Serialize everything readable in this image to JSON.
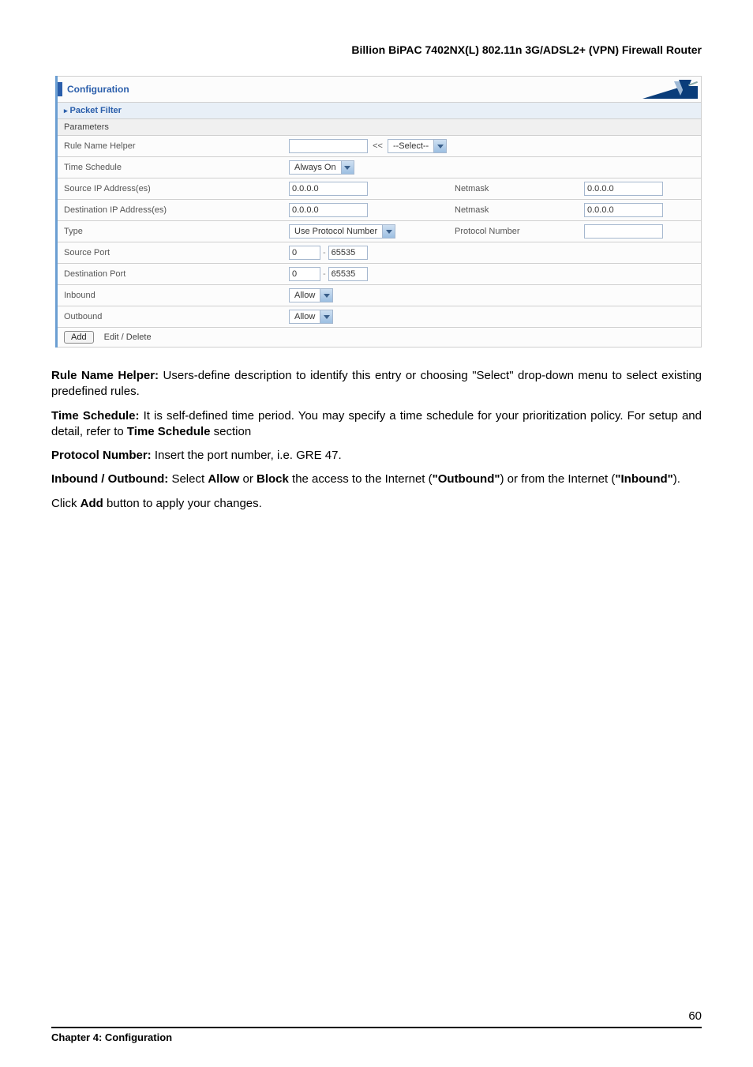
{
  "docTitle": "Billion BiPAC 7402NX(L) 802.11n 3G/ADSL2+ (VPN) Firewall Router",
  "panel": {
    "headerTitle": "Configuration",
    "sectionTitle": "Packet Filter",
    "parametersLabel": "Parameters"
  },
  "rows": {
    "ruleName": {
      "label": "Rule Name Helper",
      "inputValue": "",
      "arrow": "<<",
      "selectValue": "--Select--"
    },
    "timeSchedule": {
      "label": "Time Schedule",
      "selectValue": "Always On"
    },
    "sourceIP": {
      "label": "Source IP Address(es)",
      "value": "0.0.0.0",
      "netmaskLabel": "Netmask",
      "netmaskValue": "0.0.0.0"
    },
    "destIP": {
      "label": "Destination IP Address(es)",
      "value": "0.0.0.0",
      "netmaskLabel": "Netmask",
      "netmaskValue": "0.0.0.0"
    },
    "type": {
      "label": "Type",
      "selectValue": "Use Protocol Number",
      "protoLabel": "Protocol Number",
      "protoValue": ""
    },
    "sourcePort": {
      "label": "Source Port",
      "from": "0",
      "to": "65535"
    },
    "destPort": {
      "label": "Destination Port",
      "from": "0",
      "to": "65535"
    },
    "inbound": {
      "label": "Inbound",
      "selectValue": "Allow"
    },
    "outbound": {
      "label": "Outbound",
      "selectValue": "Allow"
    }
  },
  "buttons": {
    "add": "Add",
    "editDelete": "Edit / Delete"
  },
  "paragraphs": {
    "p1a": "Rule Name Helper:",
    "p1b": " Users-define description to identify this entry or choosing \"Select\" drop-down menu to select existing predefined rules.",
    "p2a": "Time Schedule:",
    "p2b": " It is self-defined time period.   You may specify a time schedule for your prioritization policy. For setup and detail, refer to ",
    "p2c": "Time Schedule",
    "p2d": " section",
    "p3a": "Protocol Number:",
    "p3b": " Insert the port number, i.e. GRE 47.",
    "p4a": "Inbound / Outbound:",
    "p4b": " Select ",
    "p4c": "Allow",
    "p4d": " or ",
    "p4e": "Block",
    "p4f": " the access to the Internet (",
    "p4g": "\"Outbound\"",
    "p4h": ") or from the Internet (",
    "p4i": "\"Inbound\"",
    "p4j": ").",
    "p5a": "Click ",
    "p5b": "Add",
    "p5c": " button to apply your changes."
  },
  "footer": {
    "chapter": "Chapter 4: Configuration",
    "pageNum": "60"
  }
}
